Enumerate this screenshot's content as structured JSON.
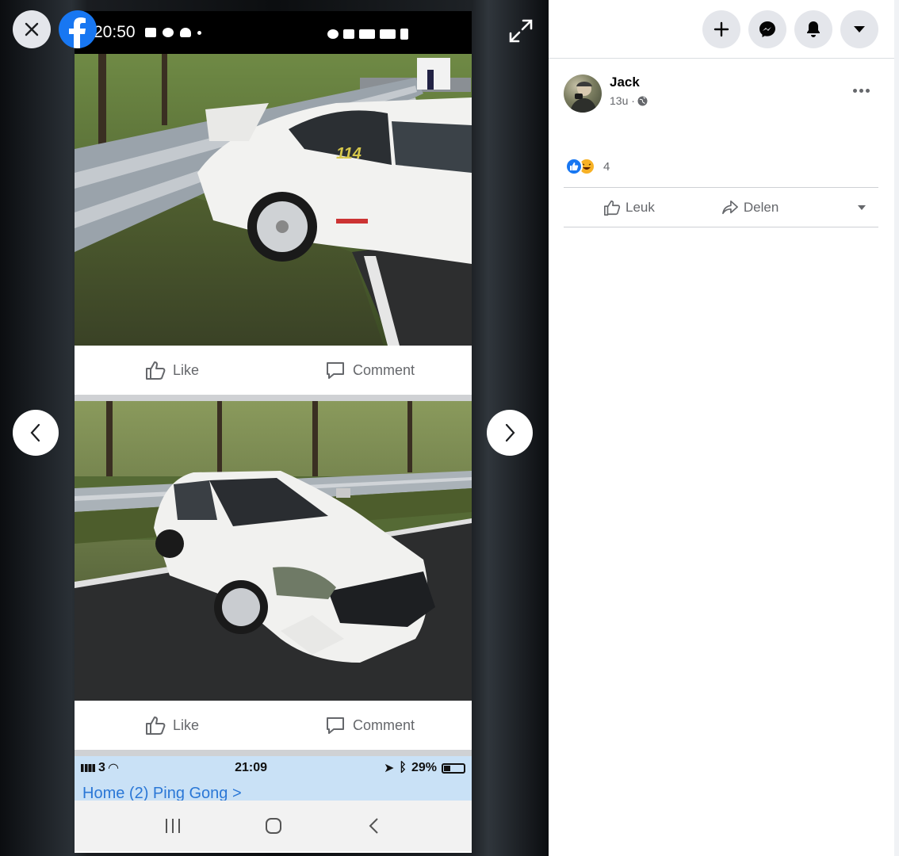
{
  "phone": {
    "status_time": "20:50",
    "post_actions": {
      "like_label": "Like",
      "comment_label": "Comment"
    },
    "ios_status": {
      "carrier": "3",
      "time": "21:09",
      "battery": "29%"
    },
    "ios_peek_text": "Home (2)      Ping Gong >"
  },
  "post": {
    "author_name": "Jack",
    "time_ago": "13u ·",
    "reaction_count": "4",
    "actions": {
      "like": "Leuk",
      "share": "Delen"
    }
  },
  "colors": {
    "facebook_blue": "#1877f2",
    "button_gray": "#e4e6eb",
    "text_secondary": "#65676b"
  }
}
